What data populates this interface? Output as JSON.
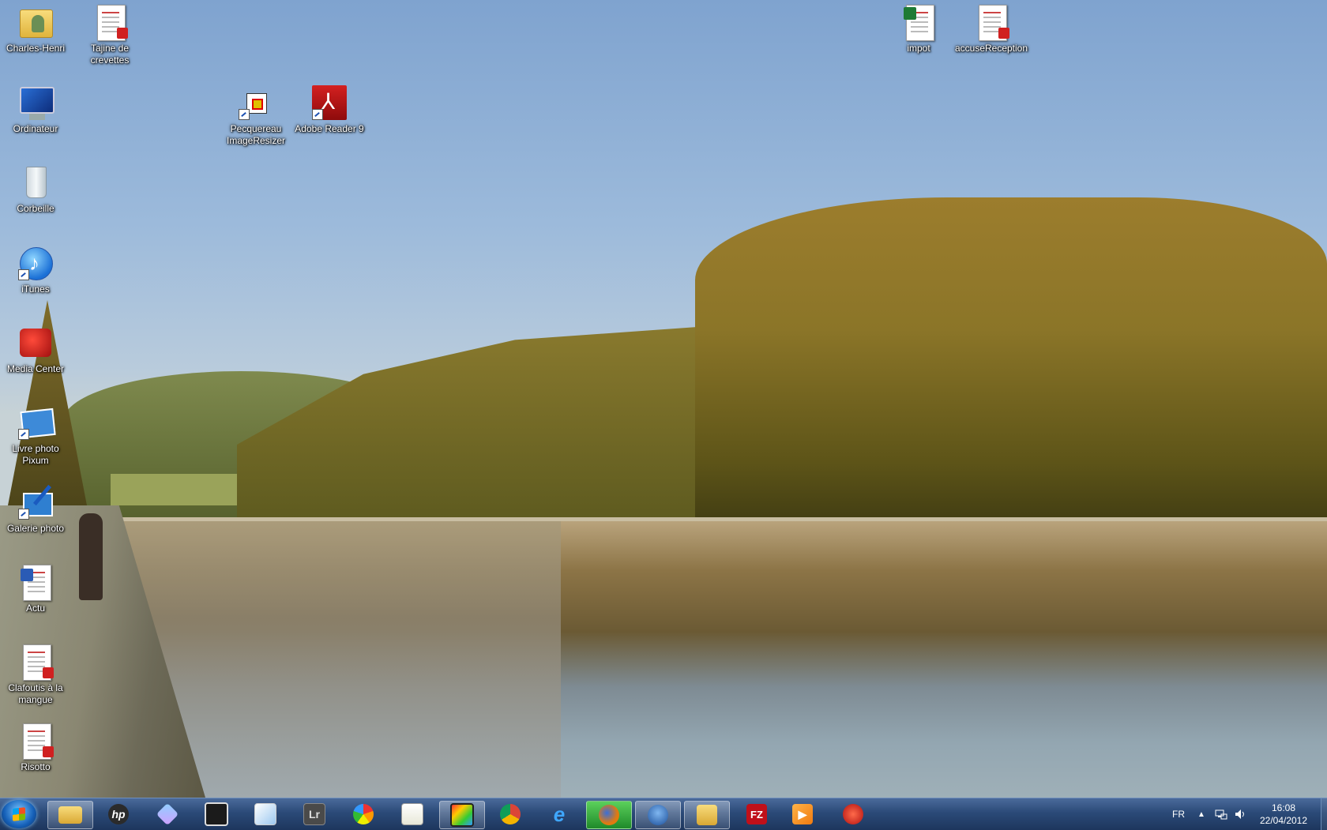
{
  "desktop": {
    "icons": [
      {
        "label": "Charles-Henri",
        "icon": "user-folder-icon"
      },
      {
        "label": "Tajine de crevettes",
        "icon": "pdf-document-icon"
      },
      {
        "label": "impot",
        "icon": "excel-document-icon"
      },
      {
        "label": "accuseReception",
        "icon": "pdf-document-icon"
      },
      {
        "label": "Ordinateur",
        "icon": "computer-icon"
      },
      {
        "label": "Pecquereau ImageResizer",
        "icon": "image-resizer-icon"
      },
      {
        "label": "Adobe Reader 9",
        "icon": "adobe-reader-icon"
      },
      {
        "label": "Corbeille",
        "icon": "recycle-bin-icon"
      },
      {
        "label": "iTunes",
        "icon": "itunes-icon"
      },
      {
        "label": "Media Center",
        "icon": "media-center-icon"
      },
      {
        "label": "Livre photo Pixum",
        "icon": "pixum-icon"
      },
      {
        "label": "Galerie photo",
        "icon": "photo-gallery-icon"
      },
      {
        "label": "Actu",
        "icon": "word-document-icon"
      },
      {
        "label": "Clafoutis à la mangue",
        "icon": "pdf-document-icon"
      },
      {
        "label": "Risotto",
        "icon": "pdf-document-icon"
      }
    ]
  },
  "taskbar": {
    "start_icon": "windows-start-icon",
    "pinned": [
      {
        "name": "explorer",
        "icon": "folder-icon",
        "active": true
      },
      {
        "name": "hp",
        "icon": "hp-icon",
        "text": "hp"
      },
      {
        "name": "app-arrow",
        "icon": "arrow-app-icon"
      },
      {
        "name": "app-media",
        "icon": "media-app-icon"
      },
      {
        "name": "paint",
        "icon": "paint-icon"
      },
      {
        "name": "lightroom",
        "icon": "lightroom-icon",
        "text": "Lr"
      },
      {
        "name": "picasa",
        "icon": "picasa-icon"
      },
      {
        "name": "notepad",
        "icon": "notepad-icon"
      },
      {
        "name": "movie-maker",
        "icon": "movie-maker-icon",
        "active": true
      },
      {
        "name": "chrome",
        "icon": "chrome-icon"
      },
      {
        "name": "ie",
        "icon": "internet-explorer-icon",
        "text": "e"
      },
      {
        "name": "firefox",
        "icon": "firefox-icon",
        "active": true
      },
      {
        "name": "thunderbird",
        "icon": "thunderbird-icon",
        "active": true
      },
      {
        "name": "explorer-window",
        "icon": "explorer-window-icon",
        "active": true
      },
      {
        "name": "filezilla",
        "icon": "filezilla-icon",
        "text": "FZ"
      },
      {
        "name": "media-player",
        "icon": "media-player-icon"
      },
      {
        "name": "app-red",
        "icon": "red-app-icon"
      }
    ],
    "tray": {
      "language": "FR",
      "time": "16:08",
      "date": "22/04/2012"
    }
  },
  "colors": {
    "taskbar": "#2b4a78",
    "sky": "#9cbadb"
  }
}
